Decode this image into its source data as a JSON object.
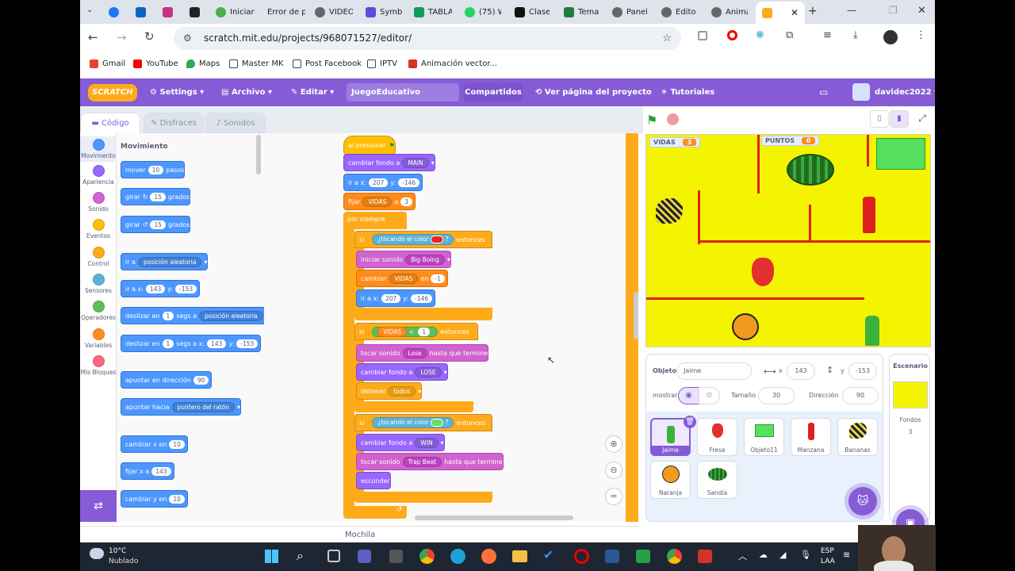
{
  "browser": {
    "tabs": [
      "Iniciar",
      "Error de pr",
      "VIDEO",
      "Symba",
      "TABLA",
      "(75) W",
      "Clases",
      "Tema",
      "Panel",
      "Editor",
      "Anima",
      ""
    ],
    "url": "scratch.mit.edu/projects/968071527/editor/",
    "bookmarks": [
      "Gmail",
      "YouTube",
      "Maps",
      "Master MK",
      "Post Facebook",
      "IPTV",
      "Animación vector..."
    ]
  },
  "menu": {
    "logo": "SCRATCH",
    "settings": "Settings",
    "file": "Archivo",
    "edit": "Editar",
    "project_title": "JuegoEducativo",
    "share": "Compartidos",
    "see_project": "Ver página del proyecto",
    "tutorials": "Tutoriales",
    "username": "davidec2022"
  },
  "editor_tabs": {
    "code": "Código",
    "costumes": "Disfraces",
    "sounds": "Sonidos"
  },
  "categories": [
    "Movimiento",
    "Apariencia",
    "Sonido",
    "Eventos",
    "Control",
    "Sensores",
    "Operadores",
    "Variables",
    "Mis Bloques"
  ],
  "category_colors": [
    "#4c97ff",
    "#9966ff",
    "#cf63cf",
    "#ffbf00",
    "#ffab19",
    "#5cb1d6",
    "#59c059",
    "#ff8c1a",
    "#ff6680"
  ],
  "palette": {
    "heading": "Movimiento",
    "move": [
      "mover",
      "10",
      "pasos"
    ],
    "turn_right": [
      "girar",
      "15",
      "grados"
    ],
    "turn_left": [
      "girar",
      "15",
      "grados"
    ],
    "goto": [
      "ir a",
      "posición aleatoria"
    ],
    "goto_xy": [
      "ir a x:",
      "143",
      "y:",
      "-153"
    ],
    "glide": [
      "deslizar en",
      "1",
      "segs a",
      "posición aleatoria"
    ],
    "glide_xy": [
      "deslizar en",
      "1",
      "segs a x:",
      "143",
      "y:",
      "-153"
    ],
    "point_dir": [
      "apuntar en dirección",
      "90"
    ],
    "point_towards": [
      "apuntar hacia",
      "puntero del ratón"
    ],
    "change_x": [
      "cambiar x en",
      "10"
    ],
    "set_x": [
      "fijar x a",
      "143"
    ],
    "change_y": [
      "cambiar y en",
      "10"
    ]
  },
  "script": {
    "hat": "al presionar",
    "switch_bg": [
      "cambiar fondo a",
      "MAIN"
    ],
    "goto_xy": [
      "ir a x:",
      "207",
      "y:",
      "-146"
    ],
    "set_var": [
      "fijar",
      "VIDAS",
      "a",
      "3"
    ],
    "forever": "por siempre",
    "if1": [
      "si",
      "¿tocando el color",
      "?",
      "entonces"
    ],
    "if1_color": "#e8241c",
    "play_sound": [
      "iniciar sonido",
      "Big Boing"
    ],
    "change_var": [
      "cambiar",
      "VIDAS",
      "en",
      "-1"
    ],
    "goto_xy2": [
      "ir a x:",
      "207",
      "y:",
      "-146"
    ],
    "if2": [
      "si",
      "VIDAS",
      "<",
      "1",
      "entonces"
    ],
    "play_until": [
      "tocar sonido",
      "Lose",
      "hasta que termine"
    ],
    "switch_bg2": [
      "cambiar fondo a",
      "LOSE"
    ],
    "stop": [
      "detener",
      "todos"
    ],
    "if3": [
      "si",
      "¿tocando el color",
      "?",
      "entonces"
    ],
    "if3_color": "#66e05a",
    "switch_bg3": [
      "cambiar fondo a",
      "WIN"
    ],
    "play_until2": [
      "tocar sonido",
      "Trap Beat",
      "hasta que termine"
    ],
    "hide": "esconder"
  },
  "backpack": "Mochila",
  "stage": {
    "var_vidas": {
      "label": "VIDAS",
      "value": "3"
    },
    "var_puntos": {
      "label": "PUNTOS",
      "value": "0"
    }
  },
  "sprite_info": {
    "object_label": "Objeto",
    "name": "Jaime",
    "x_label": "x",
    "x": "143",
    "y_label": "y",
    "y": "-153",
    "show_label": "mostrar",
    "size_label": "Tamaño",
    "size": "30",
    "direction_label": "Dirección",
    "direction": "90"
  },
  "sprites": [
    "Jaime",
    "Fresa",
    "Objeto11",
    "Manzana",
    "Bananas",
    "Naranja",
    "Sandía"
  ],
  "stage_panel": {
    "title": "Escenario",
    "backdrops_label": "Fondos",
    "backdrops_count": "3"
  },
  "taskbar": {
    "temp": "10°C",
    "weather": "Nublado",
    "lang1": "ESP",
    "lang2": "LAA"
  }
}
